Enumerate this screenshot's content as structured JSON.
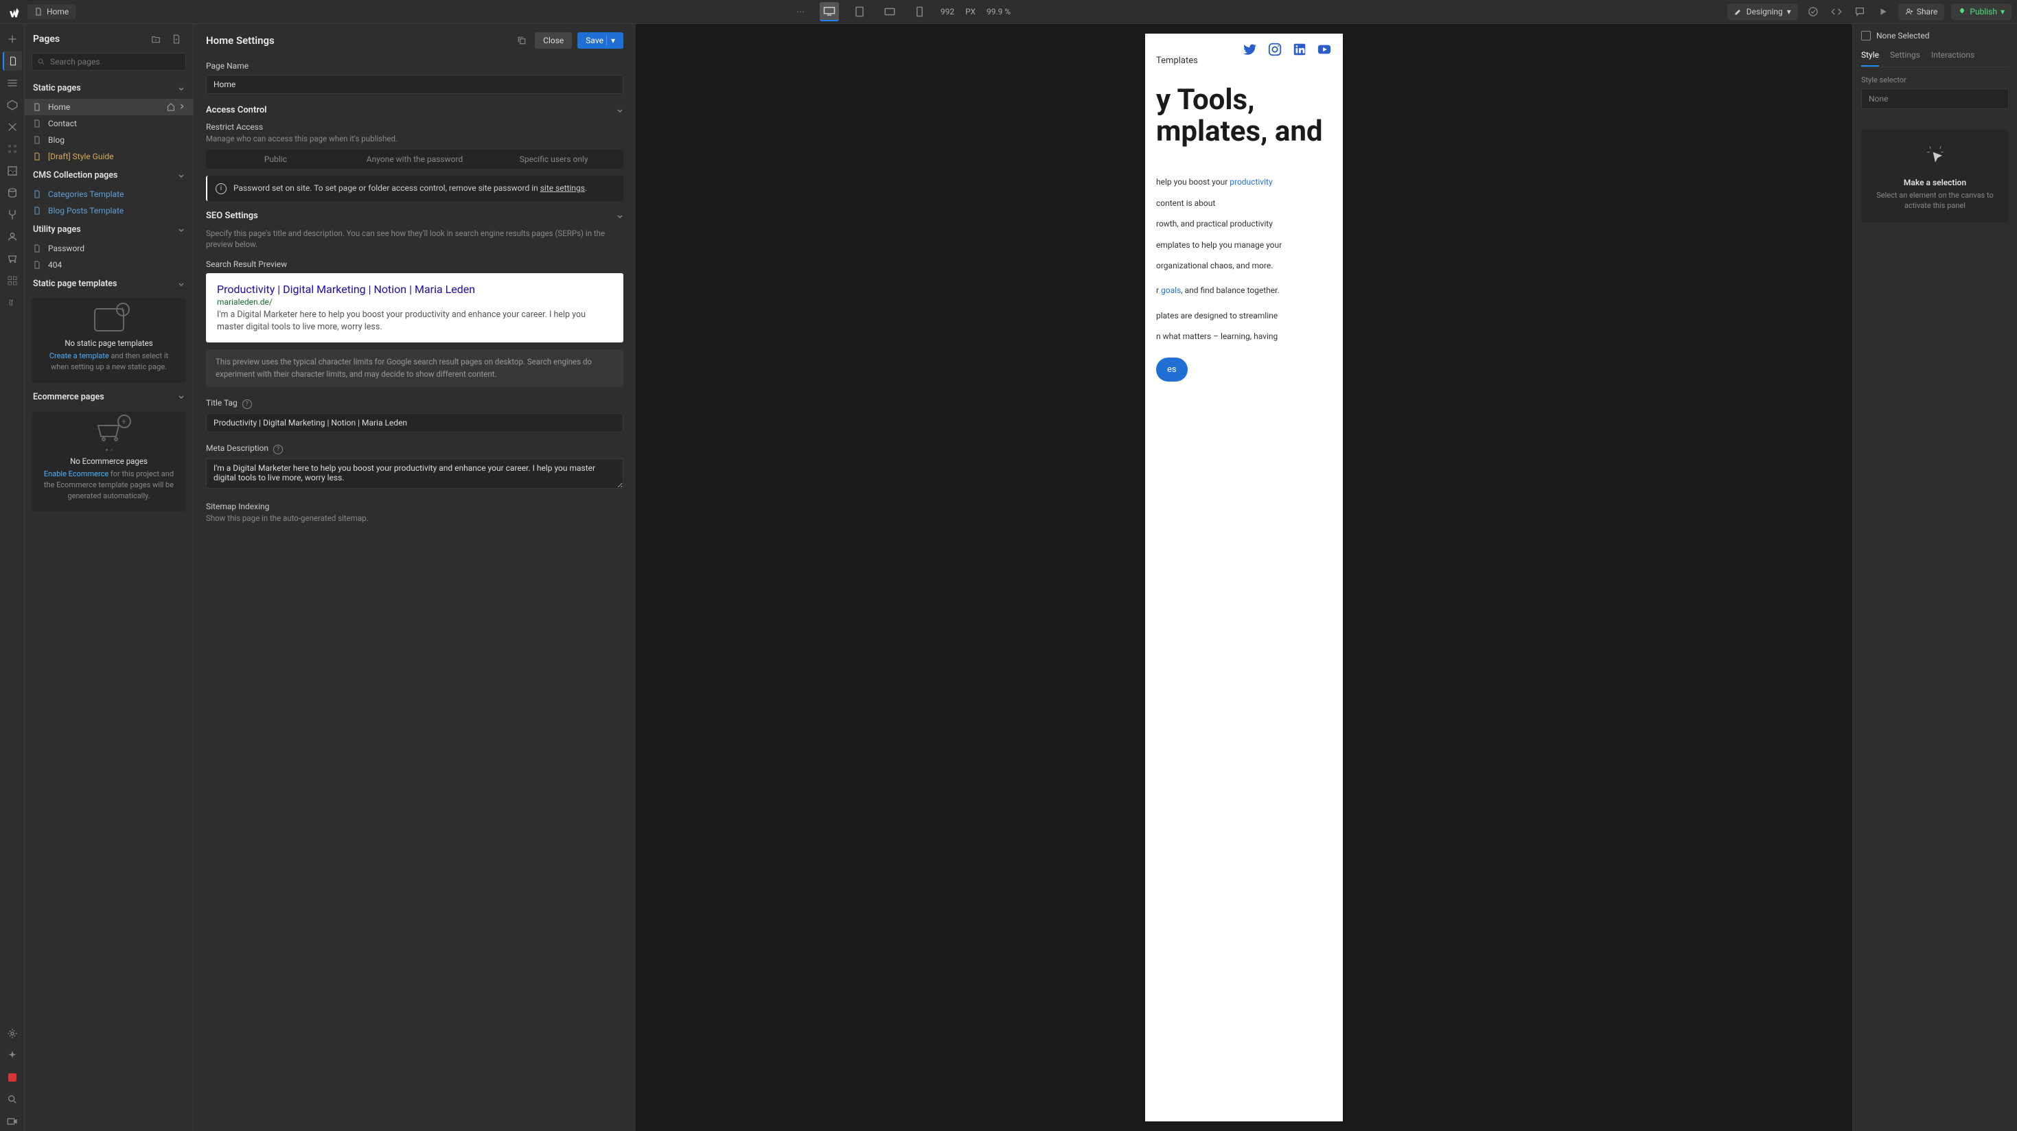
{
  "topbar": {
    "page_name": "Home",
    "width_val": "992",
    "width_unit": "PX",
    "zoom": "99.9 %",
    "mode": "Designing",
    "share": "Share",
    "publish": "Publish"
  },
  "pages": {
    "title": "Pages",
    "search_placeholder": "Search pages",
    "static_header": "Static pages",
    "static_items": [
      "Home",
      "Contact",
      "Blog",
      "[Draft] Style Guide"
    ],
    "cms_header": "CMS Collection pages",
    "cms_items": [
      "Categories Template",
      "Blog Posts Template"
    ],
    "utility_header": "Utility pages",
    "utility_items": [
      "Password",
      "404"
    ],
    "templates_header": "Static page templates",
    "templates_empty_title": "No static page templates",
    "templates_empty_link": "Create a template",
    "templates_empty_rest": " and then select it when setting up a new static page.",
    "ecom_header": "Ecommerce pages",
    "ecom_empty_title": "No Ecommerce pages",
    "ecom_empty_link": "Enable Ecommerce",
    "ecom_empty_rest": " for this project and the Ecommerce template pages will be generated automatically."
  },
  "settings": {
    "title": "Home Settings",
    "close": "Close",
    "save": "Save",
    "page_name_label": "Page Name",
    "page_name_value": "Home",
    "access_title": "Access Control",
    "restrict_label": "Restrict Access",
    "restrict_desc": "Manage who can access this page when it's published.",
    "seg_public": "Public",
    "seg_password": "Anyone with the password",
    "seg_users": "Specific users only",
    "info_text_pre": "Password set on site. To set page or folder access control, remove site password in ",
    "info_link": "site settings",
    "seo_title": "SEO Settings",
    "seo_desc": "Specify this page's title and description. You can see how they'll look in search engine results pages (SERPs) in the preview below.",
    "serp_label": "Search Result Preview",
    "serp_title": "Productivity | Digital Marketing | Notion | Maria Leden",
    "serp_url": "marialeden.de/",
    "serp_desc": "I'm a Digital Marketer here to help you boost your productivity and enhance your career. I help you master digital tools to live more, worry less.",
    "serp_note": "This preview uses the typical character limits for Google search result pages on desktop. Search engines do experiment with their character limits, and may decide to show different content.",
    "title_tag_label": "Title Tag",
    "title_tag_value": "Productivity | Digital Marketing | Notion | Maria Leden",
    "meta_label": "Meta Description",
    "meta_value": "I'm a Digital Marketer here to help you boost your productivity and enhance your career. I help you master digital tools to live more, worry less.",
    "sitemap_label": "Sitemap Indexing",
    "sitemap_desc": "Show this page in the auto-generated sitemap."
  },
  "canvas": {
    "nav_templates": "Templates",
    "hero_title": "y Tools, mplates, and",
    "p1_pre": " help you boost your ",
    "p1_link": "productivity",
    "p2a": " content is about",
    "p2b": "rowth, and practical productivity",
    "p2c": "emplates to help you manage your",
    "p2d": "organizational chaos, and more.",
    "p3_pre": "r ",
    "p3_link": "goals",
    "p3_post": ", and find balance together.",
    "p4a": "plates are designed to streamline",
    "p4b": "n what matters – learning, having",
    "cta": "es"
  },
  "right": {
    "none_selected": "None Selected",
    "tab_style": "Style",
    "tab_settings": "Settings",
    "tab_interactions": "Interactions",
    "selector_label": "Style selector",
    "selector_value": "None",
    "prompt_title": "Make a selection",
    "prompt_desc": "Select an element on the canvas to activate this panel"
  }
}
